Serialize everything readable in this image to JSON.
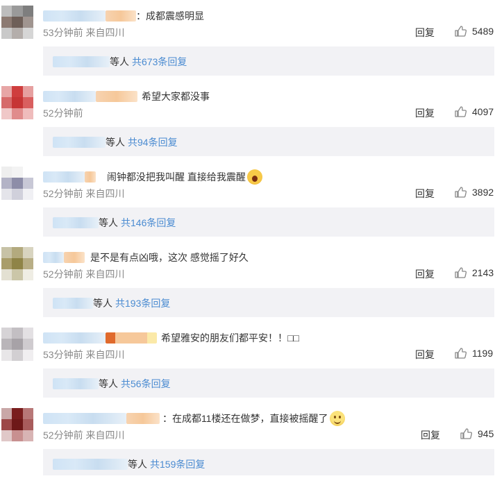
{
  "comments": [
    {
      "text": "：成都震感明显",
      "time": "53分钟前",
      "source": "来自四川",
      "reply_label": "回复",
      "likes": "5489",
      "reply_suffix": "等人",
      "reply_count": "共673条回复",
      "avatar_colors": [
        "#bdbdbd",
        "#9a9a9a",
        "#7e7e7e",
        "#8c7a72",
        "#6e5f58",
        "#a09590",
        "#c9c9c9",
        "#b4aeab",
        "#d6d6d6"
      ]
    },
    {
      "text": "希望大家都没事",
      "time": "52分钟前",
      "source": "",
      "reply_label": "回复",
      "likes": "4097",
      "reply_suffix": "等人",
      "reply_count": "共94条回复",
      "avatar_colors": [
        "#e7a6a6",
        "#cf3e3e",
        "#e6a0a0",
        "#d66a6a",
        "#c63535",
        "#d95f5f",
        "#f0c8c8",
        "#e08c8c",
        "#efbcbc"
      ]
    },
    {
      "text": "闹钟都没把我叫醒 直接给我震醒",
      "time": "52分钟前",
      "source": "来自四川",
      "reply_label": "回复",
      "likes": "3892",
      "reply_suffix": "等人",
      "reply_count": "共146条回复",
      "avatar_colors": [
        "#eeeeee",
        "#f3f3f3",
        "#ffffff",
        "#b3b3c6",
        "#8d8da8",
        "#c8c8d6",
        "#e4e4ea",
        "#d0d0db",
        "#f0f0f4"
      ]
    },
    {
      "text": "是不是有点凶哦，这次 感觉摇了好久",
      "time": "52分钟前",
      "source": "来自四川",
      "reply_label": "回复",
      "likes": "2143",
      "reply_suffix": "等人",
      "reply_count": "共193条回复",
      "avatar_colors": [
        "#c7c2a6",
        "#b3aa7e",
        "#d8d4c0",
        "#a99d6a",
        "#8f8447",
        "#b8ae86",
        "#e3e0d2",
        "#cbc6a8",
        "#efede4"
      ]
    },
    {
      "text": "希望雅安的朋友们都平安！！□□",
      "time": "53分钟前",
      "source": "来自四川",
      "reply_label": "回复",
      "likes": "1199",
      "reply_suffix": "等人",
      "reply_count": "共56条回复",
      "avatar_colors": [
        "#d6d3d6",
        "#c3bfc3",
        "#e3e0e3",
        "#b9b5b9",
        "#a7a2a7",
        "#cfcbcf",
        "#e8e6e8",
        "#d2cfd2",
        "#f0eef0"
      ]
    },
    {
      "text": "：在成都11楼还在做梦，直接被摇醒了",
      "time": "52分钟前",
      "source": "来自四川",
      "reply_label": "回复",
      "likes": "945",
      "reply_suffix": "等人",
      "reply_count": "共159条回复",
      "avatar_colors": [
        "#c9a7a7",
        "#7a1e1e",
        "#b87878",
        "#9c4848",
        "#6e1818",
        "#a85c5c",
        "#e0c8c8",
        "#c89090",
        "#d8b4b4"
      ]
    }
  ],
  "icons": {
    "like": "thumbs-up-icon",
    "emoji_scream": "scream-emoji",
    "emoji_smile": "smile-emoji"
  },
  "colors": {
    "link": "#4a8bd1",
    "meta": "#888888",
    "reply_bg": "#f2f2f5"
  }
}
